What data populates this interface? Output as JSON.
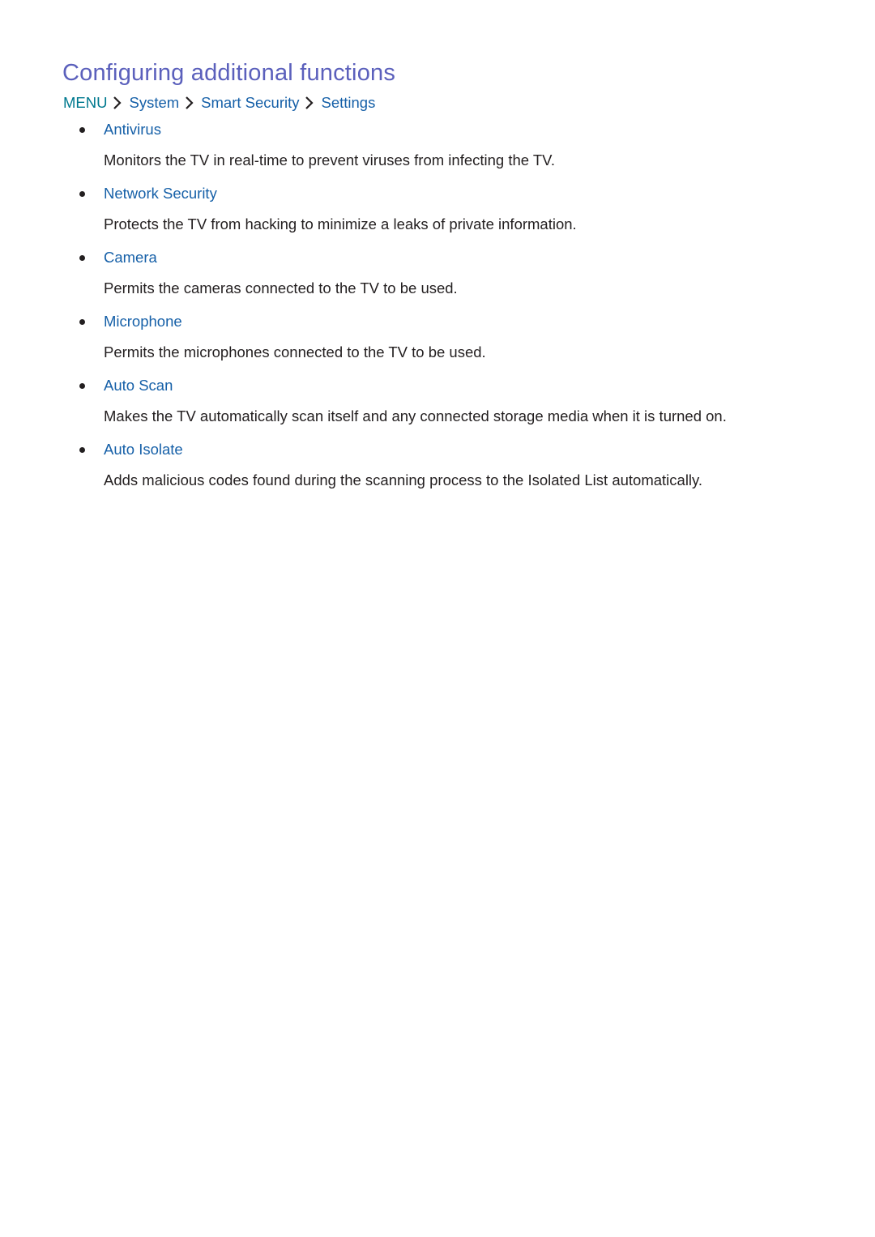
{
  "page": {
    "title": "Configuring additional functions",
    "colors": {
      "title": "#5b60bc",
      "menu": "#00798f",
      "link": "#1660a8",
      "body_text": "#231f20"
    }
  },
  "breadcrumb": {
    "items": [
      "MENU",
      "System",
      "Smart Security",
      "Settings"
    ],
    "separator_icon": "chevron-right-icon"
  },
  "settings": [
    {
      "title": "Antivirus",
      "description": "Monitors the TV in real-time to prevent viruses from infecting the TV."
    },
    {
      "title": "Network Security",
      "description": "Protects the TV from hacking to minimize a leaks of private information."
    },
    {
      "title": "Camera",
      "description": "Permits the cameras connected to the TV to be used."
    },
    {
      "title": "Microphone",
      "description": "Permits the microphones connected to the TV to be used."
    },
    {
      "title": "Auto Scan",
      "description": "Makes the TV automatically scan itself and any connected storage media when it is turned on."
    },
    {
      "title": "Auto Isolate",
      "description": "Adds malicious codes found during the scanning process to the Isolated List automatically."
    }
  ]
}
